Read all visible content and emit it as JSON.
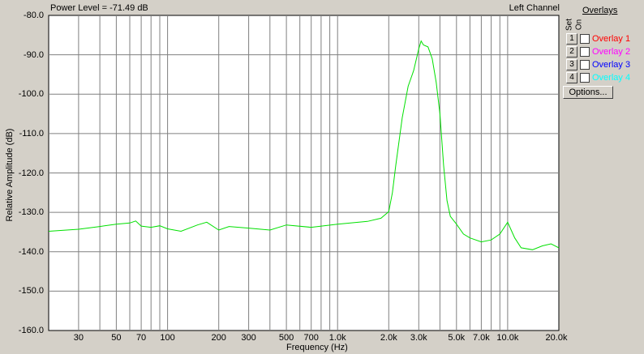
{
  "header": {
    "power_level": "Power Level = -71.49 dB",
    "channel": "Left Channel"
  },
  "overlays": {
    "title": "Overlays",
    "set_label": "Set",
    "on_label": "On",
    "items": [
      {
        "num": "1",
        "name": "Overlay 1",
        "color": "#ff0000",
        "checked": false
      },
      {
        "num": "2",
        "name": "Overlay 2",
        "color": "#ff00ff",
        "checked": false
      },
      {
        "num": "3",
        "name": "Overlay 3",
        "color": "#0000ff",
        "checked": false
      },
      {
        "num": "4",
        "name": "Overlay 4",
        "color": "#00ffff",
        "checked": false
      }
    ],
    "options_label": "Options..."
  },
  "chart_data": {
    "type": "line",
    "xlabel": "Frequency (Hz)",
    "ylabel": "Relative Amplitude (dB)",
    "x_scale": "log",
    "xlim": [
      20,
      20000
    ],
    "ylim": [
      -160,
      -80
    ],
    "grid": true,
    "y_ticks": [
      "-80.0",
      "-90.0",
      "-100.0",
      "-110.0",
      "-120.0",
      "-130.0",
      "-140.0",
      "-150.0",
      "-160.0"
    ],
    "x_tick_labels": [
      {
        "v": 30,
        "label": "30"
      },
      {
        "v": 50,
        "label": "50"
      },
      {
        "v": 70,
        "label": "70"
      },
      {
        "v": 100,
        "label": "100"
      },
      {
        "v": 200,
        "label": "200"
      },
      {
        "v": 300,
        "label": "300"
      },
      {
        "v": 500,
        "label": "500"
      },
      {
        "v": 700,
        "label": "700"
      },
      {
        "v": 1000,
        "label": "1.0k"
      },
      {
        "v": 2000,
        "label": "2.0k"
      },
      {
        "v": 3000,
        "label": "3.0k"
      },
      {
        "v": 5000,
        "label": "5.0k"
      },
      {
        "v": 7000,
        "label": "7.0k"
      },
      {
        "v": 10000,
        "label": "10.0k"
      },
      {
        "v": 20000,
        "label": "20.0k"
      }
    ],
    "series": [
      {
        "color": "#00e000",
        "x": [
          20,
          30,
          40,
          50,
          60,
          65,
          70,
          80,
          90,
          100,
          120,
          150,
          170,
          200,
          230,
          300,
          400,
          500,
          700,
          1000,
          1500,
          1800,
          2000,
          2100,
          2200,
          2400,
          2600,
          2800,
          3000,
          3100,
          3200,
          3400,
          3600,
          3800,
          4000,
          4200,
          4400,
          4600,
          5000,
          5500,
          6000,
          7000,
          8000,
          9000,
          10000,
          11000,
          12000,
          14000,
          16000,
          18000,
          20000
        ],
        "y": [
          -134.8,
          -134.3,
          -133.6,
          -133.0,
          -132.7,
          -132.2,
          -133.5,
          -133.8,
          -133.4,
          -134.2,
          -134.8,
          -133.2,
          -132.5,
          -134.5,
          -133.6,
          -134.0,
          -134.5,
          -133.2,
          -133.8,
          -133.0,
          -132.3,
          -131.5,
          -129.8,
          -125.0,
          -118.0,
          -106.0,
          -98.0,
          -94.0,
          -88.5,
          -86.5,
          -87.5,
          -88.0,
          -91.0,
          -97.0,
          -105.0,
          -118.0,
          -127.0,
          -131.0,
          -133.0,
          -135.5,
          -136.5,
          -137.5,
          -137.0,
          -135.5,
          -132.5,
          -136.5,
          -139.0,
          -139.5,
          -138.5,
          -138.0,
          -139.0
        ]
      }
    ]
  }
}
